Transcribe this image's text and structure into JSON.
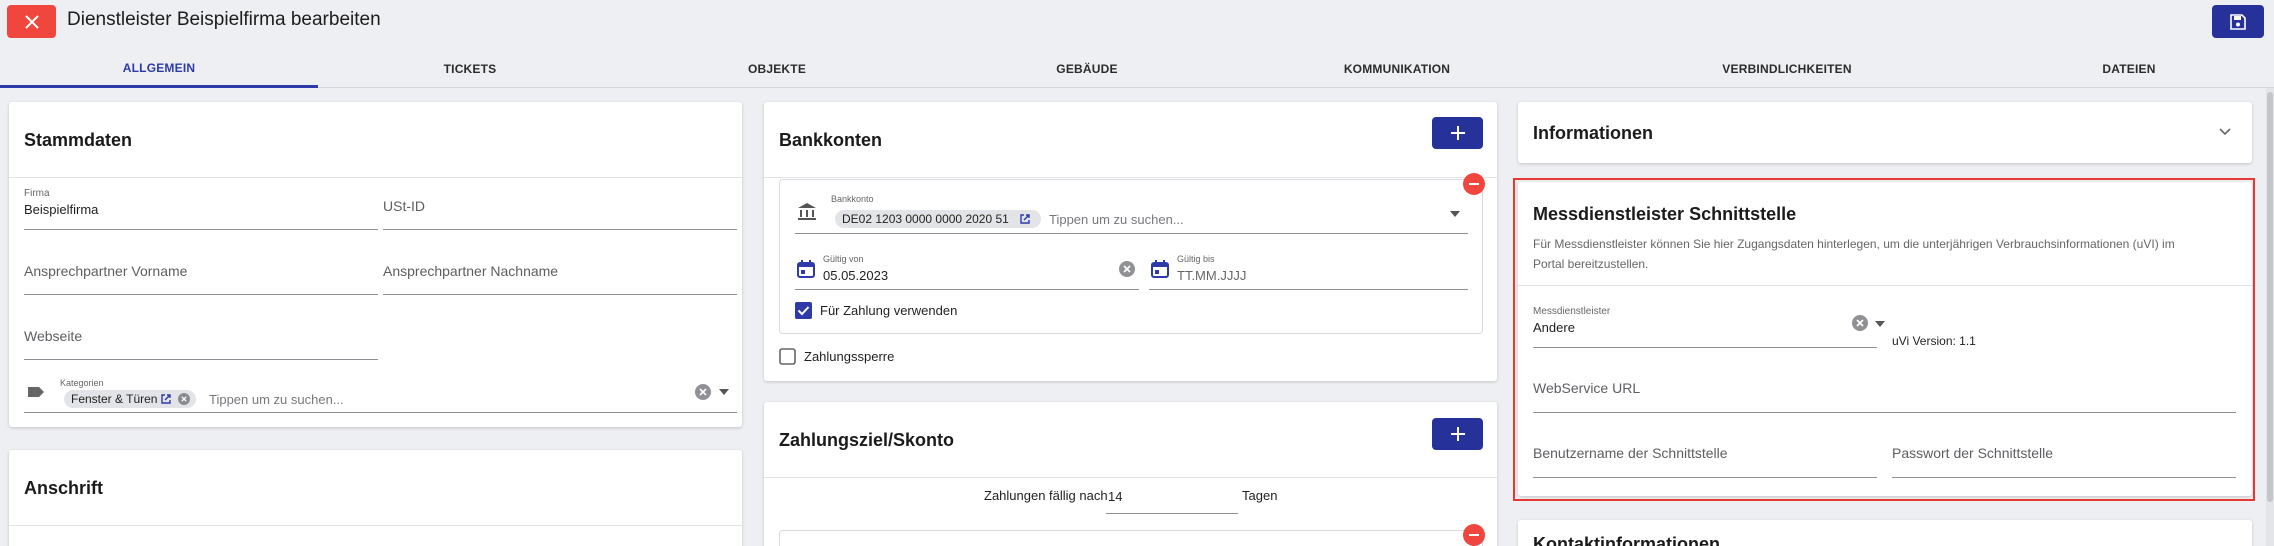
{
  "header": {
    "title": "Dienstleister Beispielfirma bearbeiten"
  },
  "tabs": [
    {
      "label": "ALLGEMEIN",
      "active": true
    },
    {
      "label": "TICKETS"
    },
    {
      "label": "OBJEKTE"
    },
    {
      "label": "GEBÄUDE"
    },
    {
      "label": "KOMMUNIKATION"
    },
    {
      "label": "VERBINDLICHKEITEN"
    },
    {
      "label": "DATEIEN"
    }
  ],
  "stammdaten": {
    "title": "Stammdaten",
    "firma_label": "Firma",
    "firma_value": "Beispielfirma",
    "ust_placeholder": "USt-ID",
    "vorname_placeholder": "Ansprechpartner Vorname",
    "nachname_placeholder": "Ansprechpartner Nachname",
    "webseite_placeholder": "Webseite",
    "kategorien_label": "Kategorien",
    "kategorie_chip": "Fenster & Türen",
    "search_placeholder": "Tippen um zu suchen..."
  },
  "anschrift": {
    "title": "Anschrift"
  },
  "bankkonten": {
    "title": "Bankkonten",
    "konto_label": "Bankkonto",
    "konto_chip": "DE02 1203 0000 0000 2020 51",
    "search_placeholder": "Tippen um zu suchen...",
    "gueltig_von_label": "Gültig von",
    "gueltig_von_value": "05.05.2023",
    "gueltig_bis_label": "Gültig bis",
    "gueltig_bis_placeholder": "TT.MM.JJJJ",
    "fuer_zahlung_label": "Für Zahlung verwenden",
    "fuer_zahlung_checked": true,
    "zahlungssperre_label": "Zahlungssperre",
    "zahlungssperre_checked": false
  },
  "zahlungsziel": {
    "title": "Zahlungsziel/Skonto",
    "prefix": "Zahlungen fällig nach",
    "days": "14",
    "suffix": "Tagen"
  },
  "informationen": {
    "title": "Informationen"
  },
  "messdienst": {
    "title": "Messdienstleister Schnittstelle",
    "description_line1": "Für Messdienstleister können Sie hier Zugangsdaten hinterlegen, um die unterjährigen Verbrauchsinformationen (uVI) im",
    "description_line2": "Portal bereitzustellen.",
    "select_label": "Messdienstleister",
    "select_value": "Andere",
    "uvi_version": "uVi Version: 1.1",
    "webservice_placeholder": "WebService URL",
    "benutzer_placeholder": "Benutzername der Schnittstelle",
    "passwort_placeholder": "Passwort der Schnittstelle"
  },
  "kontakt": {
    "title": "Kontaktinformationen"
  },
  "colors": {
    "accent": "#27319a",
    "danger": "#f0463d",
    "highlight": "#e53935"
  }
}
